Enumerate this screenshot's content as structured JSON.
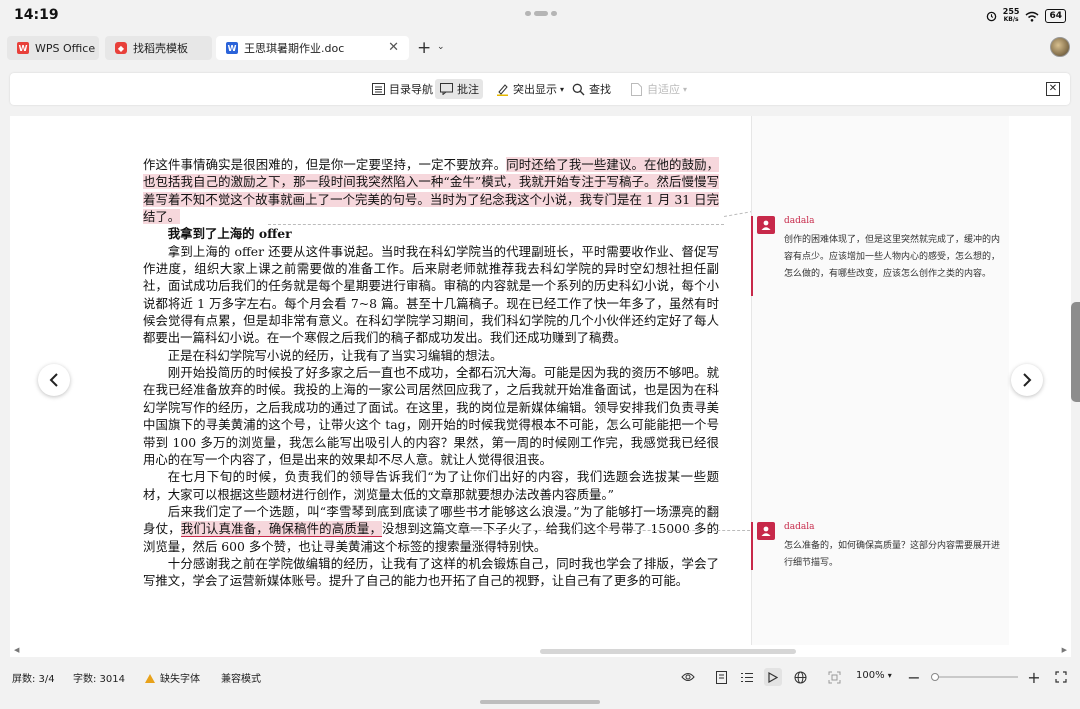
{
  "status": {
    "time": "14:19",
    "net_speed": "255",
    "net_unit": "KB/s",
    "battery": "64"
  },
  "tabs": [
    {
      "label": "WPS Office",
      "icon": "wps-logo-icon"
    },
    {
      "label": "找稻壳模板",
      "icon": "docer-icon"
    },
    {
      "label": "王思琪暑期作业.doc",
      "icon": "word-doc-icon"
    }
  ],
  "toolbar": {
    "outline": "目录导航",
    "comments": "批注",
    "highlight": "突出显示",
    "find": "查找",
    "autofit": "自适应"
  },
  "document": {
    "p1_pre": "作这件事情确实是很困难的，但是你一定要坚持，一定不要放弃。",
    "p1_hl": "同时还给了我一些建议。在他的鼓励，也包括我自己的激励之下，那一段时间我突然陷入一种“金牛”模式，我就开始专注于写稿子。然后慢慢写着写着不知不觉这个故事就画上了一个完美的句号。当时为了纪念我这个小说，我专门是在 1 月 31 日完结了。",
    "heading": "我拿到了上海的 offer",
    "p2": "拿到上海的 offer 还要从这件事说起。当时我在科幻学院当的代理副班长，平时需要收作业、督促写作进度，组织大家上课之前需要做的准备工作。后来尉老师就推荐我去科幻学院的异时空幻想社担任副社，面试成功后我们的任务就是每个星期要进行审稿。审稿的内容就是一个系列的历史科幻小说，每个小说都将近 1 万多字左右。每个月会看 7~8 篇。甚至十几篇稿子。现在已经工作了快一年多了，虽然有时候会觉得有点累，但是却非常有意义。在科幻学院学习期间，我们科幻学院的几个小伙伴还约定好了每人都要出一篇科幻小说。在一个寒假之后我们的稿子都成功发出。我们还成功赚到了稿费。",
    "p3": "正是在科幻学院写小说的经历，让我有了当实习编辑的想法。",
    "p4": "刚开始投简历的时候投了好多家之后一直也不成功，全都石沉大海。可能是因为我的资历不够吧。就在我已经准备放弃的时候。我投的上海的一家公司居然回应我了，之后我就开始准备面试，也是因为在科幻学院写作的经历，之后我成功的通过了面试。在这里，我的岗位是新媒体编辑。领导安排我们负责寻美中国旗下的寻美黄浦的这个号，让带火这个 tag，刚开始的时候我觉得根本不可能，怎么可能能把一个号带到 100 多万的浏览量，我怎么能写出吸引人的内容？果然，第一周的时候刚工作完，我感觉我已经很用心的在写一个内容了，但是出来的效果却不尽人意。就让人觉得很沮丧。",
    "p5": "在七月下旬的时候，负责我们的领导告诉我们“为了让你们出好的内容，我们选题会选拔某一些题材，大家可以根据这些题材进行创作，浏览量太低的文章那就要想办法改善内容质量。”",
    "p6_pre": "后来我们定了一个选题，叫“李雪琴到底到底读了哪些书才能够这么浪漫。”为了能够打一场漂亮的翻身仗，",
    "p6_hl": "我们认真准备，确保稿件的高质量，",
    "p6_post": "没想到这篇文章一下子火了，给我们这个号带了 15000 多的浏览量，然后 600 多个赞，也让寻美黄浦这个标签的搜索量涨得特别快。",
    "p7": "十分感谢我之前在学院做编辑的经历，让我有了这样的机会锻炼自己，同时我也学会了排版，学会了写推文，学会了运营新媒体账号。提升了自己的能力也开拓了自己的视野，让自己有了更多的可能。"
  },
  "comments": [
    {
      "author": "dadala",
      "text": "创作的困难体现了，但是这里突然就完成了，缓冲的内容有点少。应该增加一些人物内心的感受，怎么想的，怎么做的，有哪些改变，应该怎么创作之类的内容。"
    },
    {
      "author": "dadala",
      "text": "怎么准备的，如何确保高质量？这部分内容需要展开进行细节描写。"
    }
  ],
  "bottom": {
    "page": "屏数: 3/4",
    "words": "字数: 3014",
    "missing_font": "缺失字体",
    "compat": "兼容模式",
    "zoom": "100%"
  },
  "colors": {
    "comment_accent": "#c7294a",
    "highlight": "#f6d7dc",
    "wps_red": "#e8403a",
    "word_blue": "#2b63d9"
  }
}
